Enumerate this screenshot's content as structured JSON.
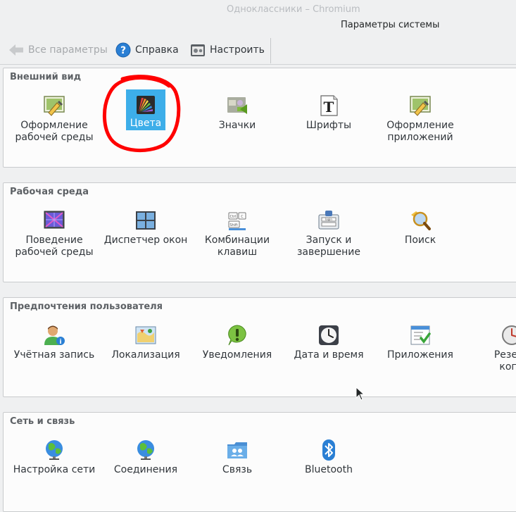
{
  "window": {
    "ghost_title": "Одноклассники – Chromium",
    "title": "Параметры системы"
  },
  "toolbar": {
    "all_settings": "Все параметры",
    "help": "Справка",
    "configure": "Настроить"
  },
  "groups": [
    {
      "title": "Внешний вид",
      "items": [
        {
          "label": "Оформление\nрабочей среды",
          "icon": "workspace-theme-icon"
        },
        {
          "label": "Цвета",
          "icon": "colors-icon",
          "selected": true
        },
        {
          "label": "Значки",
          "icon": "icons-icon"
        },
        {
          "label": "Шрифты",
          "icon": "fonts-icon"
        },
        {
          "label": "Оформление\nприложений",
          "icon": "application-style-icon"
        }
      ]
    },
    {
      "title": "Рабочая среда",
      "items": [
        {
          "label": "Поведение\nрабочей среды",
          "icon": "workspace-behavior-icon"
        },
        {
          "label": "Диспетчер окон",
          "icon": "window-manager-icon"
        },
        {
          "label": "Комбинации\nклавиш",
          "icon": "shortcuts-icon"
        },
        {
          "label": "Запуск и\nзавершение",
          "icon": "startup-shutdown-icon"
        },
        {
          "label": "Поиск",
          "icon": "search-icon"
        }
      ]
    },
    {
      "title": "Предпочтения пользователя",
      "items": [
        {
          "label": "Учётная запись",
          "icon": "account-icon"
        },
        {
          "label": "Локализация",
          "icon": "localization-icon"
        },
        {
          "label": "Уведомления",
          "icon": "notifications-icon"
        },
        {
          "label": "Дата и время",
          "icon": "clock-icon"
        },
        {
          "label": "Приложения",
          "icon": "applications-icon"
        },
        {
          "label": "Резерв\nкопи",
          "icon": "backup-icon"
        }
      ]
    },
    {
      "title": "Сеть и связь",
      "items": [
        {
          "label": "Настройка сети",
          "icon": "globe-icon"
        },
        {
          "label": "Соединения",
          "icon": "globe-icon"
        },
        {
          "label": "Связь",
          "icon": "sharing-folder-icon"
        },
        {
          "label": "Bluetooth",
          "icon": "bluetooth-icon"
        }
      ]
    }
  ],
  "colors": {
    "selection": "#3daee9",
    "annotation": "#ff0000"
  }
}
